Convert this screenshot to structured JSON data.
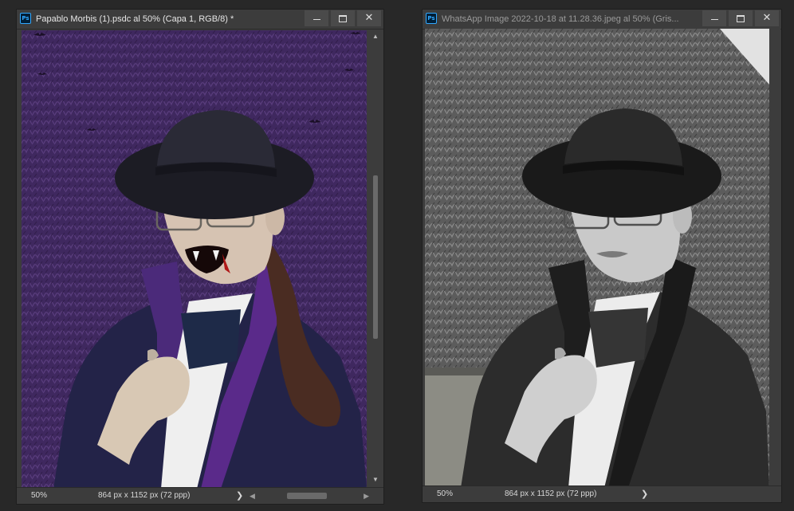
{
  "windows": [
    {
      "app_icon": "Ps",
      "title": "Papablo Morbis (1).psdc al 50% (Capa 1, RGB/8) *",
      "zoom": "50%",
      "doc_info": "864 px x 1152 px (72 ppp)",
      "status_arrow": "❯",
      "scroll_left": "◀",
      "scroll_right": "▶",
      "scroll_up": "▲",
      "scroll_down": "▼",
      "minimize": "—",
      "maximize": "☐",
      "close": "✕"
    },
    {
      "app_icon": "Ps",
      "title": "WhatsApp Image 2022-10-18 at 11.28.36.jpeg al 50% (Gris...",
      "zoom": "50%",
      "doc_info": "864 px x 1152 px (72 ppp)",
      "status_arrow": "❯",
      "minimize": "—",
      "maximize": "☐",
      "close": "✕"
    }
  ],
  "colors": {
    "app_background": "#282828",
    "panel": "#3c3c3c",
    "ps_brand": "#31a8ff",
    "purple_background": "#4a2e6e",
    "coat_navy": "#232348"
  }
}
